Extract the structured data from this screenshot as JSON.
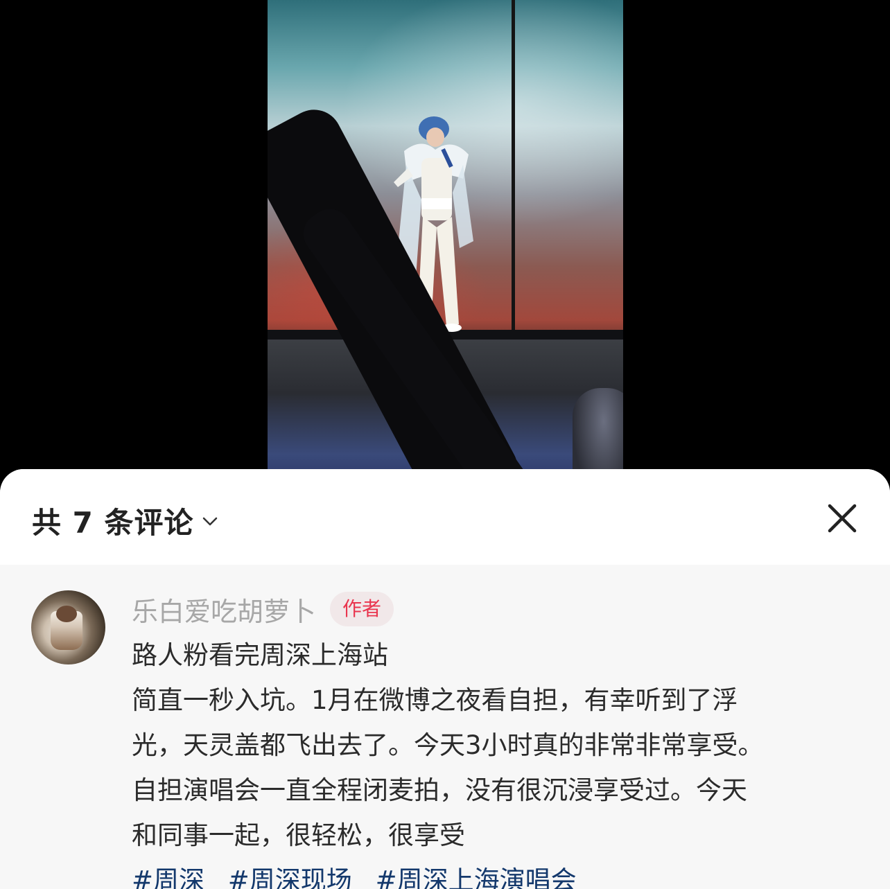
{
  "comments_panel": {
    "count_label": "共 7 条评论"
  },
  "comment": {
    "username": "乐白爱吃胡萝卜",
    "badge": "作者",
    "lines": [
      "路人粉看完周深上海站",
      "简直一秒入坑。1月在微博之夜看自担，有幸听到了浮",
      "光，天灵盖都飞出去了。今天3小时真的非常非常享受。",
      "自担演唱会一直全程闭麦拍，没有很沉浸享受过。今天",
      "和同事一起，很轻松，很享受"
    ],
    "hashtags": [
      "#周深",
      "#周深现场",
      "#周深上海演唱会"
    ]
  },
  "colors": {
    "badge_text": "#e9354e",
    "badge_bg": "#f1e8e9",
    "hashtag": "#13386c",
    "username": "#a7a7a7"
  },
  "icons": [
    "chevron-down-icon",
    "close-icon"
  ]
}
